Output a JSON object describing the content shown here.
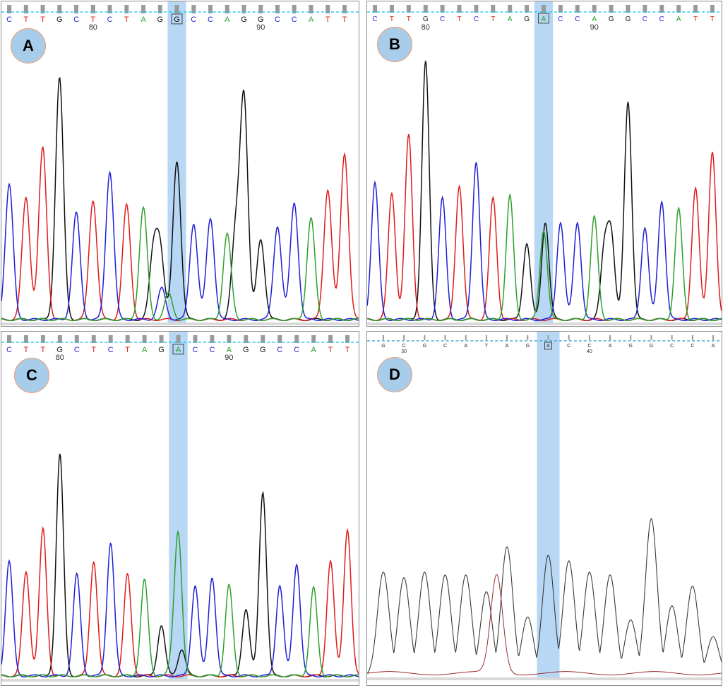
{
  "colors": {
    "A": "#2ca02c",
    "C": "#1f1fd6",
    "G": "#111111",
    "T": "#e01b1b",
    "highlight": "#aad0f2",
    "baseline_dash": "#1ec8e6",
    "qv_bar": "#9a9a9a"
  },
  "chart_data": [
    {
      "type": "line",
      "panel_label": "A",
      "bases": [
        "C",
        "T",
        "T",
        "G",
        "C",
        "T",
        "C",
        "T",
        "A",
        "G",
        "G",
        "C",
        "C",
        "A",
        "G",
        "G",
        "C",
        "C",
        "A",
        "T",
        "T"
      ],
      "position_labels": [
        {
          "index": 5,
          "text": "80"
        },
        {
          "index": 15,
          "text": "90"
        }
      ],
      "highlight_index": 10,
      "boxed_index": 10,
      "peak_heights": [
        0.52,
        0.47,
        0.66,
        0.93,
        0.41,
        0.46,
        0.57,
        0.44,
        0.43,
        0.26,
        0.61,
        0.37,
        0.39,
        0.33,
        0.85,
        0.31,
        0.36,
        0.45,
        0.39,
        0.5,
        0.64
      ],
      "extra_peaks": [
        {
          "base": "G",
          "at": 8.6,
          "height": 0.25
        },
        {
          "base": "C",
          "at": 9.1,
          "height": 0.12
        },
        {
          "base": "A",
          "at": 9.5,
          "height": 0.1
        },
        {
          "base": "G",
          "at": 13.5,
          "height": 0.32
        }
      ]
    },
    {
      "type": "line",
      "panel_label": "B",
      "bases": [
        "C",
        "T",
        "T",
        "G",
        "C",
        "T",
        "C",
        "T",
        "A",
        "G",
        "A",
        "C",
        "C",
        "A",
        "G",
        "G",
        "C",
        "C",
        "A",
        "T",
        "T"
      ],
      "position_labels": [
        {
          "index": 3,
          "text": "80"
        },
        {
          "index": 13,
          "text": "90"
        }
      ],
      "highlight_index": 10,
      "boxed_index": 10,
      "peak_heights": [
        0.52,
        0.48,
        0.7,
        0.98,
        0.46,
        0.51,
        0.6,
        0.46,
        0.47,
        0.29,
        0.34,
        0.37,
        0.37,
        0.39,
        0.31,
        0.83,
        0.35,
        0.45,
        0.42,
        0.5,
        0.64
      ],
      "extra_peaks": [
        {
          "base": "G",
          "at": 10.1,
          "height": 0.37
        },
        {
          "base": "G",
          "at": 13.6,
          "height": 0.26
        }
      ]
    },
    {
      "type": "line",
      "panel_label": "C",
      "bases": [
        "C",
        "T",
        "T",
        "G",
        "C",
        "T",
        "C",
        "T",
        "A",
        "G",
        "A",
        "C",
        "C",
        "A",
        "G",
        "G",
        "C",
        "C",
        "A",
        "T",
        "T"
      ],
      "position_labels": [
        {
          "index": 3,
          "text": "80"
        },
        {
          "index": 13,
          "text": "90"
        }
      ],
      "highlight_index": 10,
      "boxed_index": 10,
      "peak_heights": [
        0.43,
        0.39,
        0.55,
        0.83,
        0.38,
        0.43,
        0.5,
        0.38,
        0.36,
        0.19,
        0.52,
        0.34,
        0.37,
        0.34,
        0.25,
        0.69,
        0.34,
        0.42,
        0.33,
        0.43,
        0.55
      ],
      "extra_peaks": [
        {
          "base": "G",
          "at": 10.2,
          "height": 0.1
        },
        {
          "base": "A",
          "at": 9.7,
          "height": 0.06
        }
      ]
    },
    {
      "type": "line",
      "panel_label": "D",
      "bases": [
        "G",
        "C",
        "G",
        "C",
        "A",
        "T",
        "A",
        "G",
        "A",
        "C",
        "C",
        "A",
        "G",
        "G",
        "C",
        "C",
        "A"
      ],
      "position_labels": [
        {
          "index": 1,
          "text": "30"
        },
        {
          "index": 10,
          "text": "40"
        }
      ],
      "highlight_index": 8,
      "boxed_index": 8,
      "trace_color": "#3a3a3a",
      "secondary_color": "#9e2b2b",
      "peak_heights": [
        0.37,
        0.35,
        0.37,
        0.36,
        0.36,
        0.3,
        0.46,
        0.21,
        0.43,
        0.41,
        0.37,
        0.36,
        0.2,
        0.56,
        0.25,
        0.32,
        0.14
      ],
      "secondary_peaks": [
        {
          "at": 5.5,
          "height": 0.35
        }
      ]
    }
  ]
}
